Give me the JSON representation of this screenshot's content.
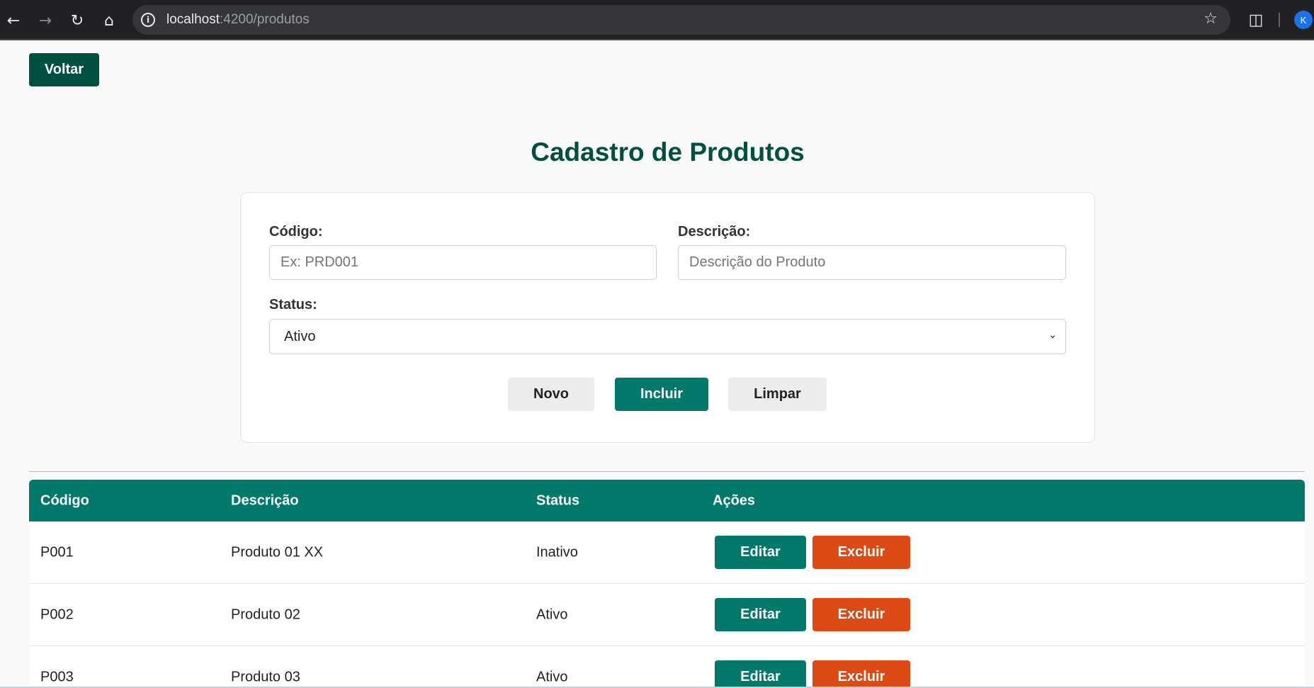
{
  "browser": {
    "url_host": "localhost",
    "url_rest": ":4200/produtos",
    "profile_initial": "K"
  },
  "page": {
    "back_label": "Voltar",
    "title": "Cadastro de Produtos"
  },
  "form": {
    "codigo_label": "Código:",
    "codigo_placeholder": "Ex: PRD001",
    "descricao_label": "Descrição:",
    "descricao_placeholder": "Descrição do Produto",
    "status_label": "Status:",
    "status_value": "Ativo",
    "novo_label": "Novo",
    "incluir_label": "Incluir",
    "limpar_label": "Limpar"
  },
  "table": {
    "headers": [
      "Código",
      "Descrição",
      "Status",
      "Ações"
    ],
    "rows": [
      {
        "codigo": "P001",
        "descricao": "Produto 01 XX",
        "status": "Inativo"
      },
      {
        "codigo": "P002",
        "descricao": "Produto 02",
        "status": "Ativo"
      },
      {
        "codigo": "P003",
        "descricao": "Produto 03",
        "status": "Ativo"
      }
    ],
    "edit_label": "Editar",
    "delete_label": "Excluir"
  },
  "colors": {
    "primary_dark": "#00503f",
    "primary": "#00796b",
    "danger": "#dc4a16"
  },
  "icons": [
    "back-arrow-icon",
    "forward-arrow-icon",
    "reload-icon",
    "home-icon",
    "info-icon",
    "star-icon",
    "extensions-icon",
    "chevron-down-icon"
  ]
}
